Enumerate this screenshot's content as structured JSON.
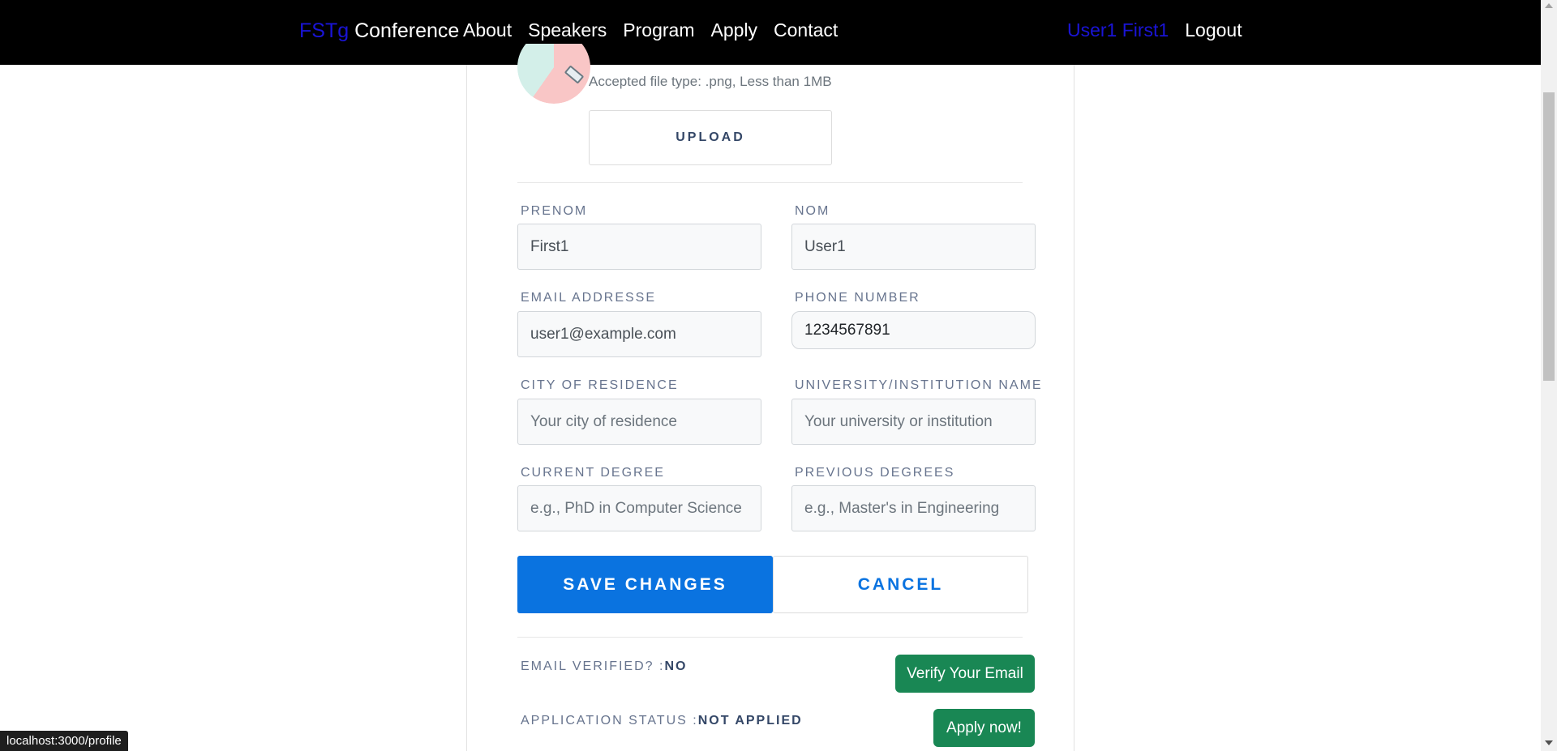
{
  "navbar": {
    "brand_prefix": "FSTg",
    "brand_suffix": "Conference",
    "links": [
      "About",
      "Speakers",
      "Program",
      "Apply",
      "Contact"
    ],
    "user": "User1 First1",
    "logout": "Logout"
  },
  "profile": {
    "file_hint": "Accepted file type: .png, Less than 1MB",
    "upload_label": "UPLOAD"
  },
  "form": {
    "prenom": {
      "label": "PRENOM",
      "value": "First1",
      "placeholder": ""
    },
    "nom": {
      "label": "NOM",
      "value": "User1",
      "placeholder": ""
    },
    "email": {
      "label": "EMAIL ADDRESSE",
      "value": "user1@example.com",
      "placeholder": ""
    },
    "phone": {
      "label": "PHONE NUMBER",
      "value": "1234567891",
      "placeholder": ""
    },
    "city": {
      "label": "CITY OF RESIDENCE",
      "value": "",
      "placeholder": "Your city of residence"
    },
    "university": {
      "label": "UNIVERSITY/INSTITUTION NAME",
      "value": "",
      "placeholder": "Your university or institution"
    },
    "current_degree": {
      "label": "CURRENT DEGREE",
      "value": "",
      "placeholder": "e.g., PhD in Computer Science"
    },
    "previous_degrees": {
      "label": "PREVIOUS DEGREES",
      "value": "",
      "placeholder": "e.g., Master's in Engineering"
    },
    "save_label": "SAVE CHANGES",
    "cancel_label": "CANCEL"
  },
  "status": {
    "email_verified_label": "EMAIL VERIFIED? :",
    "email_verified_value": "NO",
    "verify_button": "Verify Your Email",
    "application_label": "APPLICATION STATUS :",
    "application_value": "NOT APPLIED",
    "apply_button": "Apply now!"
  },
  "browser": {
    "status_url": "localhost:3000/profile"
  },
  "colors": {
    "navbar_bg": "#000000",
    "brand_accent": "#1a14d6",
    "primary": "#0a73e0",
    "success": "#198754"
  }
}
